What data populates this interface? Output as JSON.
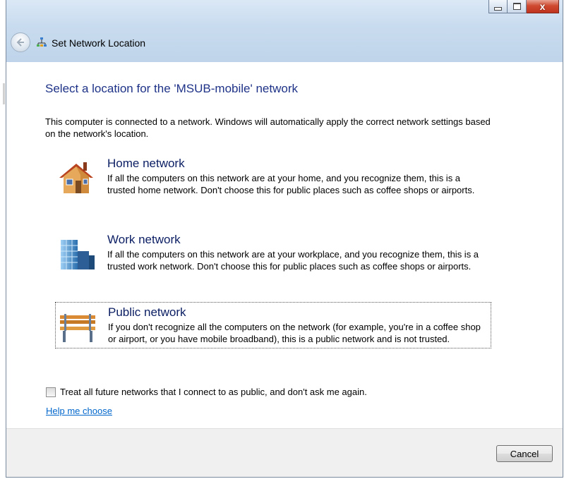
{
  "window": {
    "title": "Set Network Location",
    "controls": {
      "minimize": "",
      "maximize": "",
      "close": "x"
    }
  },
  "nav": {
    "back_icon": "back-arrow-icon",
    "title_icon": "network-icon"
  },
  "heading": "Select a location for the 'MSUB-mobile' network",
  "intro": "This computer is connected to a network. Windows will automatically apply the correct network settings based on the network's location.",
  "options": [
    {
      "title": "Home network",
      "description": "If all the computers on this network are at your home, and you recognize them, this is a trusted home network.  Don't choose this for public places such as coffee shops or airports.",
      "icon": "home-icon"
    },
    {
      "title": "Work network",
      "description": "If all the computers on this network are at your workplace, and you recognize them, this is a trusted work network.  Don't choose this for public places such as coffee shops or airports.",
      "icon": "office-building-icon"
    },
    {
      "title": "Public network",
      "description": "If you don't recognize all the computers on the network (for example, you're in a coffee shop or airport, or you have mobile broadband), this is a public network and is not trusted.",
      "icon": "park-bench-icon"
    }
  ],
  "treat_public_checkbox": {
    "label": "Treat all future networks that I connect to as public, and don't ask me again.",
    "checked": false
  },
  "help_link": "Help me choose",
  "footer": {
    "cancel_label": "Cancel"
  },
  "colors": {
    "heading": "#1e3287",
    "option_title": "#0b1e63",
    "link": "#0066cc",
    "close_button": "#c0331e"
  }
}
